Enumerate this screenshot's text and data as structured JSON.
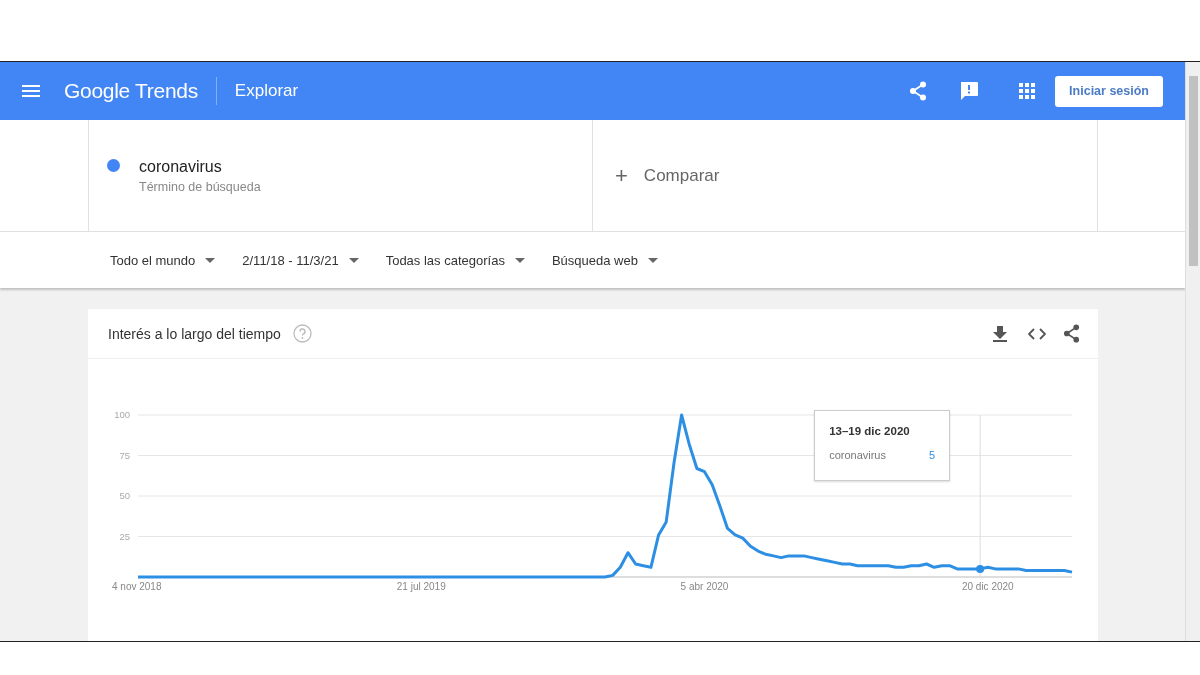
{
  "header": {
    "logo": "Google Trends",
    "page_title": "Explorar",
    "sign_in_button": "Iniciar sesión"
  },
  "terms": [
    {
      "term": "coronavirus",
      "subtitle": "Término de búsqueda",
      "color": "#4285f4"
    }
  ],
  "compare": {
    "icon": "+",
    "label": "Comparar"
  },
  "filters": [
    {
      "label": "Todo el mundo"
    },
    {
      "label": "2/11/18 - 11/3/21"
    },
    {
      "label": "Todas las categorías"
    },
    {
      "label": "Búsqueda web"
    }
  ],
  "card": {
    "title": "Interés a lo largo del tiempo",
    "tooltip": {
      "date": "13–19 dic 2020",
      "value": "5"
    },
    "chart_data": {
      "type": "line",
      "categories": [
        "4 nov 2018",
        null,
        null,
        null,
        null,
        null,
        null,
        null,
        null,
        null,
        null,
        null,
        null,
        null,
        null,
        null,
        null,
        null,
        null,
        null,
        null,
        null,
        null,
        null,
        null,
        null,
        null,
        null,
        null,
        null,
        null,
        null,
        null,
        null,
        null,
        null,
        null,
        "21 jul 2019",
        null,
        null,
        null,
        null,
        null,
        null,
        null,
        null,
        null,
        null,
        null,
        null,
        null,
        null,
        null,
        null,
        null,
        null,
        null,
        null,
        null,
        null,
        null,
        null,
        null,
        null,
        null,
        null,
        null,
        null,
        null,
        null,
        null,
        null,
        null,
        null,
        "5 abr 2020",
        null,
        null,
        null,
        null,
        null,
        null,
        null,
        null,
        null,
        null,
        null,
        null,
        null,
        null,
        null,
        null,
        null,
        null,
        null,
        null,
        null,
        null,
        null,
        null,
        null,
        null,
        null,
        null,
        null,
        null,
        null,
        null,
        null,
        null,
        null,
        null,
        "20 dic 2020",
        null,
        null,
        null,
        null,
        null,
        null,
        null,
        null,
        null,
        null,
        null
      ],
      "series": [
        {
          "name": "coronavirus",
          "color": "#2d8fe3",
          "values": [
            0,
            0,
            0,
            0,
            0,
            0,
            0,
            0,
            0,
            0,
            0,
            0,
            0,
            0,
            0,
            0,
            0,
            0,
            0,
            0,
            0,
            0,
            0,
            0,
            0,
            0,
            0,
            0,
            0,
            0,
            0,
            0,
            0,
            0,
            0,
            0,
            0,
            0,
            0,
            0,
            0,
            0,
            0,
            0,
            0,
            0,
            0,
            0,
            0,
            0,
            0,
            0,
            0,
            0,
            0,
            0,
            0,
            0,
            0,
            0,
            0,
            0,
            1,
            6,
            15,
            8,
            7,
            6,
            26,
            34,
            70,
            100,
            82,
            67,
            65,
            57,
            44,
            30,
            26,
            24,
            19,
            16,
            14,
            13,
            12,
            13,
            13,
            13,
            12,
            11,
            10,
            9,
            8,
            8,
            7,
            7,
            7,
            7,
            7,
            6,
            6,
            7,
            7,
            8,
            6,
            7,
            7,
            5,
            5,
            5,
            5,
            6,
            5,
            5,
            5,
            5,
            4,
            4,
            4,
            4,
            4,
            4,
            3
          ]
        }
      ],
      "ylim": [
        0,
        100
      ],
      "yticks": [
        25,
        50,
        75,
        100
      ],
      "grid": true
    }
  }
}
